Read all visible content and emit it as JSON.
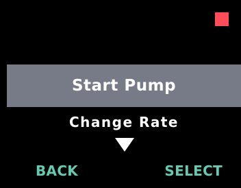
{
  "status": {
    "indicator_color": "#ff4d5a"
  },
  "menu": {
    "selected_label": "Start Pump",
    "next_label": "Change Rate",
    "highlight_color": "#777b88",
    "scroll_icon": "triangle-down-icon"
  },
  "softkeys": {
    "left_label": "BACK",
    "right_label": "SELECT",
    "color": "#6ac7b0"
  }
}
